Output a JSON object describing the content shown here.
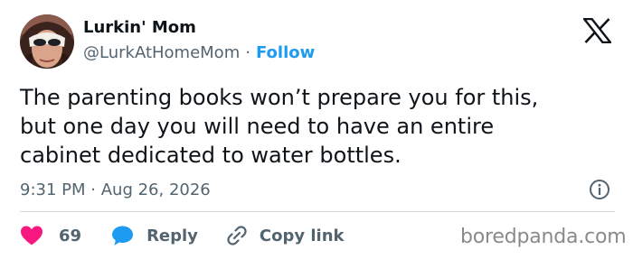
{
  "author": {
    "name": "Lurkin' Mom",
    "handle": "@LurkAtHomeMom",
    "separator": "·",
    "follow_label": "Follow"
  },
  "tweet": {
    "lines": [
      "The parenting books won’t prepare you for this,",
      "but one day you will need to have an entire",
      "cabinet dedicated to water bottles."
    ],
    "time": "9:31 PM",
    "date_separator": "·",
    "date": "Aug 26, 2026"
  },
  "actions": {
    "like_count": "69",
    "reply_label": "Reply",
    "copy_label": "Copy link"
  },
  "icons": [
    "x-logo-icon",
    "info-icon",
    "heart-icon",
    "reply-bubble-icon",
    "link-icon"
  ],
  "colors": {
    "accent": "#1d9bf0",
    "like": "#f91880",
    "text": "#0f1419",
    "muted": "#536471",
    "divider": "#cfd9de"
  },
  "watermark": "boredpanda.com"
}
